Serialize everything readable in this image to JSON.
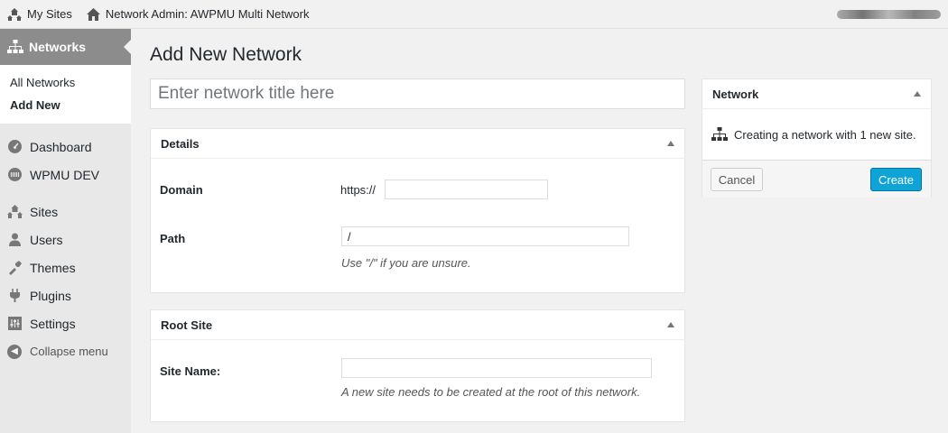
{
  "adminbar": {
    "my_sites": "My Sites",
    "network_admin": "Network Admin: AWPMU Multi Network"
  },
  "sidebar": {
    "current": "Networks",
    "submenu": [
      "All Networks",
      "Add New"
    ],
    "items": [
      "Dashboard",
      "WPMU DEV",
      "Sites",
      "Users",
      "Themes",
      "Plugins",
      "Settings"
    ],
    "collapse": "Collapse menu"
  },
  "main": {
    "page_title": "Add New Network",
    "title_placeholder": "Enter network title here",
    "details": {
      "heading": "Details",
      "domain_label": "Domain",
      "domain_prefix": "https://",
      "domain_value": "",
      "path_label": "Path",
      "path_value": "/",
      "path_hint": "Use \"/\" if you are unsure."
    },
    "root_site": {
      "heading": "Root Site",
      "site_name_label": "Site Name:",
      "site_name_value": "",
      "site_name_hint": "A new site needs to be created at the root of this network."
    }
  },
  "network_box": {
    "heading": "Network",
    "message": "Creating a network with 1 new site.",
    "cancel_label": "Cancel",
    "create_label": "Create"
  },
  "colors": {
    "primary_button": "#0ea5d6",
    "menu_current": "#8c8c8c",
    "background": "#f1f1f1"
  },
  "icons": [
    "sites-icon",
    "home-icon",
    "network-icon",
    "dashboard-icon",
    "wpmudev-icon",
    "users-icon",
    "themes-icon",
    "plugins-icon",
    "settings-icon",
    "collapse-icon"
  ]
}
